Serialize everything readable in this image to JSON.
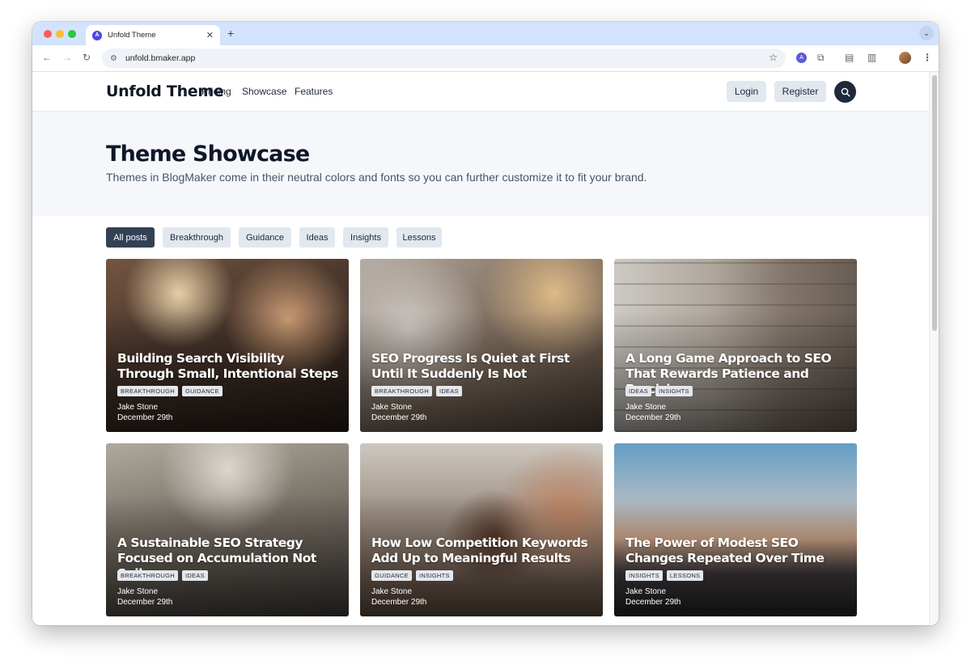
{
  "browser": {
    "tab_title": "Unfold Theme",
    "tab_favicon_letter": "A",
    "url": "unfold.bmaker.app"
  },
  "header": {
    "brand": "Unfold Theme",
    "nav": [
      "Pricing",
      "Showcase",
      "Features"
    ],
    "login_label": "Login",
    "register_label": "Register",
    "accent_color": "#1e293b"
  },
  "hero": {
    "title": "Theme Showcase",
    "subtitle": "Themes in BlogMaker come in their neutral colors and fonts so you can further customize it to fit your brand."
  },
  "filters": [
    {
      "label": "All posts",
      "active": true
    },
    {
      "label": "Breakthrough",
      "active": false
    },
    {
      "label": "Guidance",
      "active": false
    },
    {
      "label": "Ideas",
      "active": false
    },
    {
      "label": "Insights",
      "active": false
    },
    {
      "label": "Lessons",
      "active": false
    }
  ],
  "posts": [
    {
      "title": "Building Search Visibility Through Small, Intentional Steps",
      "tags": [
        "BREAKTHROUGH",
        "GUIDANCE"
      ],
      "author": "Jake Stone",
      "date": "December 29th",
      "image": "concert-crowd"
    },
    {
      "title": "SEO Progress Is Quiet at First Until It Suddenly Is Not",
      "tags": [
        "BREAKTHROUGH",
        "IDEAS"
      ],
      "author": "Jake Stone",
      "date": "December 29th",
      "image": "people-smiling"
    },
    {
      "title": "A Long Game Approach to SEO That Rewards Patience and Precision",
      "tags": [
        "IDEAS",
        "INSIGHTS"
      ],
      "author": "Jake Stone",
      "date": "December 29th",
      "image": "library-shelves"
    },
    {
      "title": "A Sustainable SEO Strategy Focused on Accumulation Not Spikes",
      "tags": [
        "BREAKTHROUGH",
        "IDEAS"
      ],
      "author": "Jake Stone",
      "date": "December 29th",
      "image": "busy-station"
    },
    {
      "title": "How Low Competition Keywords Add Up to Meaningful Results",
      "tags": [
        "GUIDANCE",
        "INSIGHTS"
      ],
      "author": "Jake Stone",
      "date": "December 29th",
      "image": "violinist-street"
    },
    {
      "title": "The Power of Modest SEO Changes Repeated Over Time",
      "tags": [
        "INSIGHTS",
        "LESSONS"
      ],
      "author": "Jake Stone",
      "date": "December 29th",
      "image": "palm-crosswalk"
    }
  ]
}
